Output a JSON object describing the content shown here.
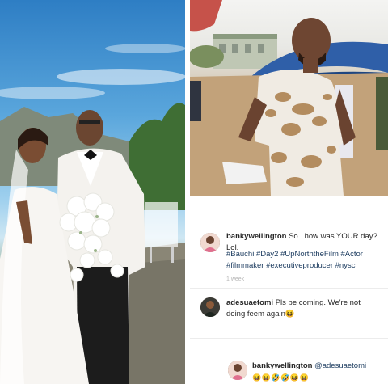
{
  "post": {
    "caption": {
      "username": "bankywellington",
      "text": " So.. how was YOUR day? Lol.",
      "hashtags_line1": "#Bauchi #Day2 #UpNorththeFilm #Actor",
      "hashtags_line2": "#filmmaker #executiveproducer #nysc",
      "meta": "1 week"
    },
    "comments": [
      {
        "username": "adesuaetomi",
        "text_line1": " Pls be coming. We're not",
        "text_line2": "doing feem again",
        "emoji": "😆"
      },
      {
        "username": "bankywellington",
        "text": " @adesuaetomi",
        "emojis": "😆😆🤣🤣😆😆"
      }
    ]
  },
  "icons": {
    "avatar_banky": "avatar-icon",
    "avatar_adesua": "avatar-icon"
  },
  "colors": {
    "hashtag": "#1a3a5e",
    "text": "#262626",
    "meta": "#b5b5b5"
  }
}
